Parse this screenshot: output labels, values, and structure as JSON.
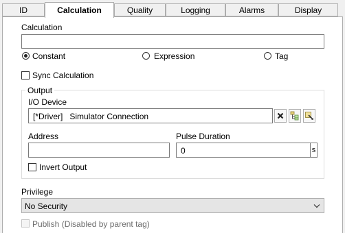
{
  "tabs": [
    "ID",
    "Calculation",
    "Quality",
    "Logging",
    "Alarms",
    "Display"
  ],
  "active_tab": "Calculation",
  "calculation": {
    "label": "Calculation",
    "value": "",
    "options": [
      {
        "label": "Constant",
        "checked": true
      },
      {
        "label": "Expression",
        "checked": false
      },
      {
        "label": "Tag",
        "checked": false
      }
    ]
  },
  "sync_calculation": {
    "label": "Sync Calculation",
    "checked": false
  },
  "output": {
    "group_label": "Output",
    "io_device_label": "I/O Device",
    "io_device_value": "[*Driver]   Simulator Connection",
    "io_buttons": [
      "clear-icon",
      "browse-tree-icon",
      "edit-device-icon"
    ],
    "address_label": "Address",
    "address_value": "",
    "pulse_duration_label": "Pulse Duration",
    "pulse_duration_value": "0",
    "pulse_duration_unit": "s",
    "invert_output": {
      "label": "Invert Output",
      "checked": false
    }
  },
  "privilege": {
    "label": "Privilege",
    "selected": "No Security"
  },
  "publish": {
    "label": "Publish (Disabled by parent tag)",
    "checked": false,
    "disabled": true
  },
  "colors": {
    "panel": "#ffffff",
    "background": "#f0f0f0",
    "border": "#adadad",
    "disabled_text": "#6d6d6d"
  }
}
